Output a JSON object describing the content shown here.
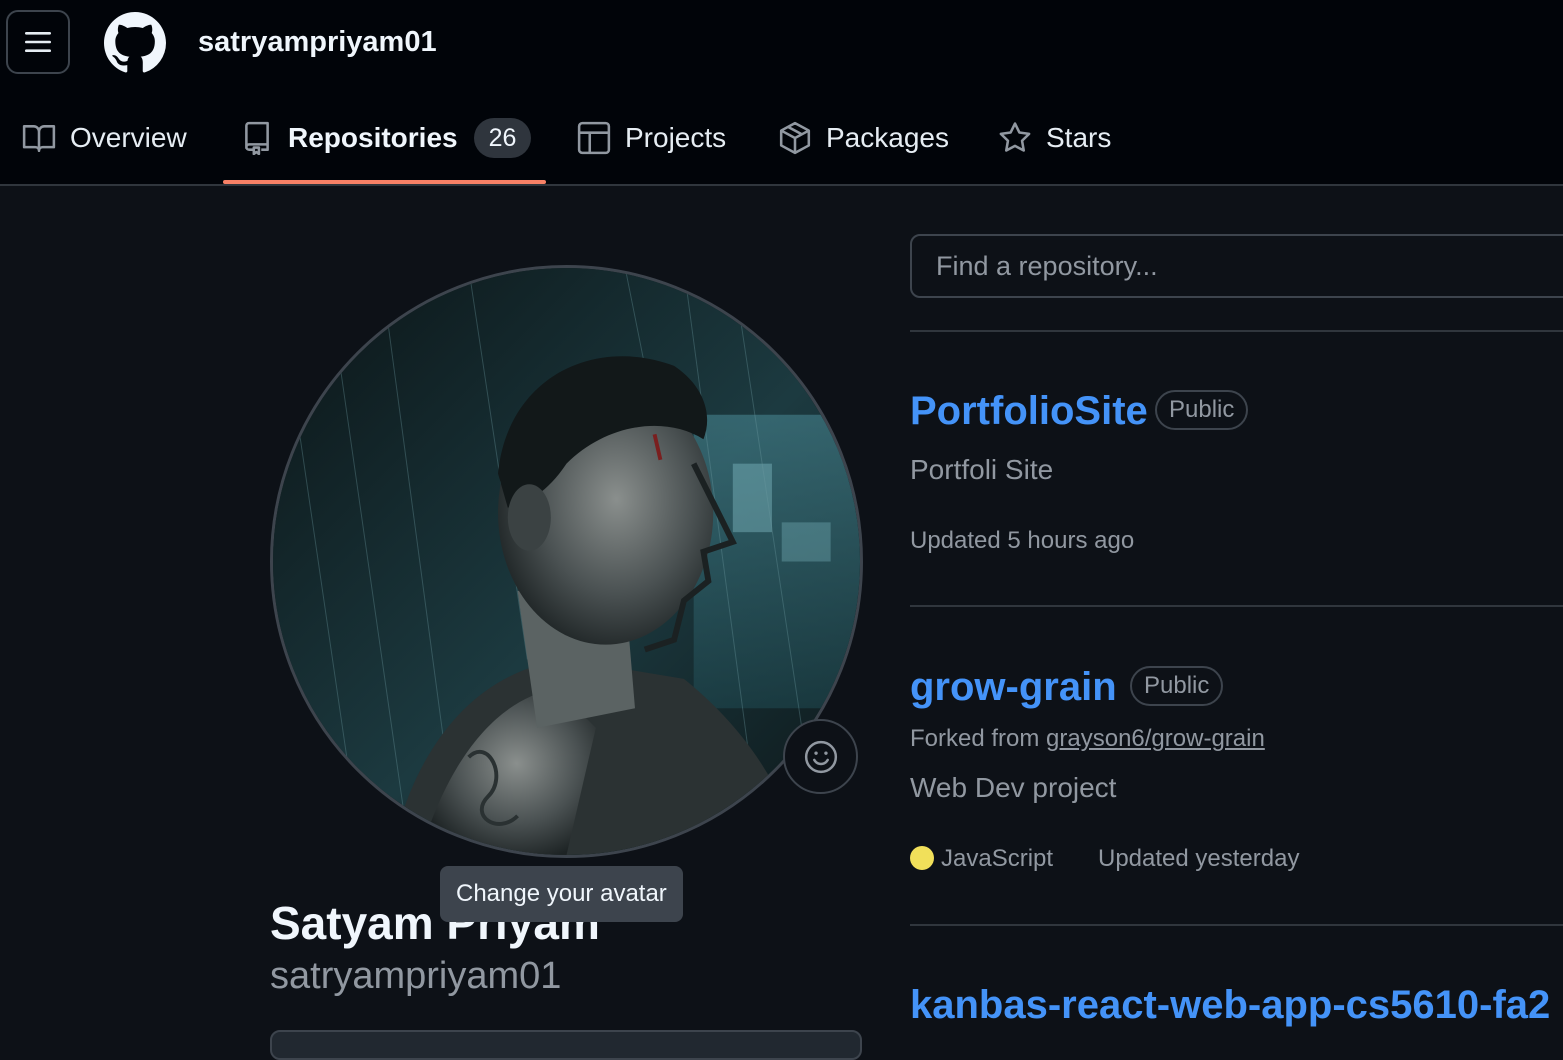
{
  "header": {
    "username": "satryampriyam01",
    "tabs": [
      {
        "label": "Overview",
        "icon": "book-icon"
      },
      {
        "label": "Repositories",
        "icon": "repo-icon",
        "count": "26",
        "selected": true
      },
      {
        "label": "Projects",
        "icon": "table-icon"
      },
      {
        "label": "Packages",
        "icon": "package-icon"
      },
      {
        "label": "Stars",
        "icon": "star-icon"
      }
    ]
  },
  "profile": {
    "full_name": "Satyam Priyam",
    "login": "satryampriyam01",
    "tooltip": "Change your avatar"
  },
  "repo_search": {
    "placeholder": "Find a repository..."
  },
  "repositories": [
    {
      "name": "PortfolioSite",
      "visibility": "Public",
      "description": "Portfoli Site",
      "updated": "Updated 5 hours ago"
    },
    {
      "name": "grow-grain",
      "visibility": "Public",
      "forked_prefix": "Forked from ",
      "forked_from": "grayson6/grow-grain",
      "description": "Web Dev project",
      "language": "JavaScript",
      "language_color": "#f1e05a",
      "updated": "Updated yesterday"
    },
    {
      "name": "kanbas-react-web-app-cs5610-fa2"
    }
  ],
  "colors": {
    "background": "#0d1117",
    "header": "#010409",
    "link": "#4493f8",
    "accent_underline": "#f78166",
    "muted_text": "#9198a1"
  }
}
